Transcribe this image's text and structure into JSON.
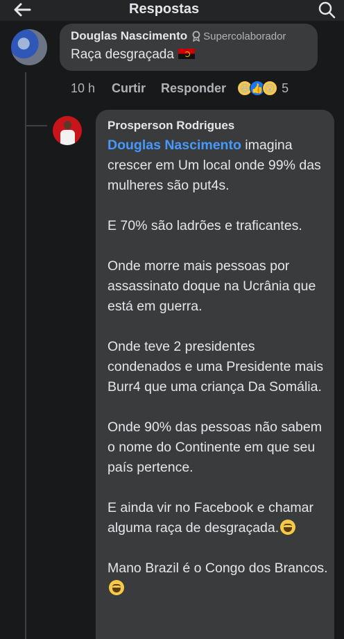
{
  "header": {
    "title": "Respostas",
    "back_icon": "arrow-left-icon",
    "search_icon": "search-icon"
  },
  "comment": {
    "author": "Douglas Nascimento",
    "badge": "Supercolaborador",
    "badge_icon": "award-icon",
    "text": "Raça desgraçada",
    "flag_icon": "angola-flag-icon",
    "time": "10 h",
    "like_label": "Curtir",
    "reply_label": "Responder",
    "reaction_icons": [
      "haha-icon",
      "like-icon",
      "wow-icon"
    ],
    "reaction_count": "5"
  },
  "reply": {
    "author": "Prosperson Rodrigues",
    "mention": "Douglas Nascimento",
    "line1_rest": " imagina crescer em Um local onde 99% das mulheres são put4s.",
    "paragraphs": [
      "E 70% são ladrões e traficantes.",
      "Onde morre mais pessoas por assassinato doque na Ucrânia que está em guerra.",
      "Onde teve 2 presidentes condenados e uma Presidente mais Burr4 que uma criança Da Somália.",
      "Onde 90% das pessoas não sabem o nome do Continente em que seu país pertence."
    ],
    "p6": "E ainda vir no Facebook e chamar alguma raça de desgraçada.",
    "p7": "Mano Brazil é o Congo dos Brancos.",
    "emoji_icon": "laughing-tears-emoji-icon"
  },
  "colors": {
    "background": "#18191a",
    "bubble": "#3a3b3c",
    "mention": "#4599ff",
    "muted": "#b0b3b8"
  }
}
